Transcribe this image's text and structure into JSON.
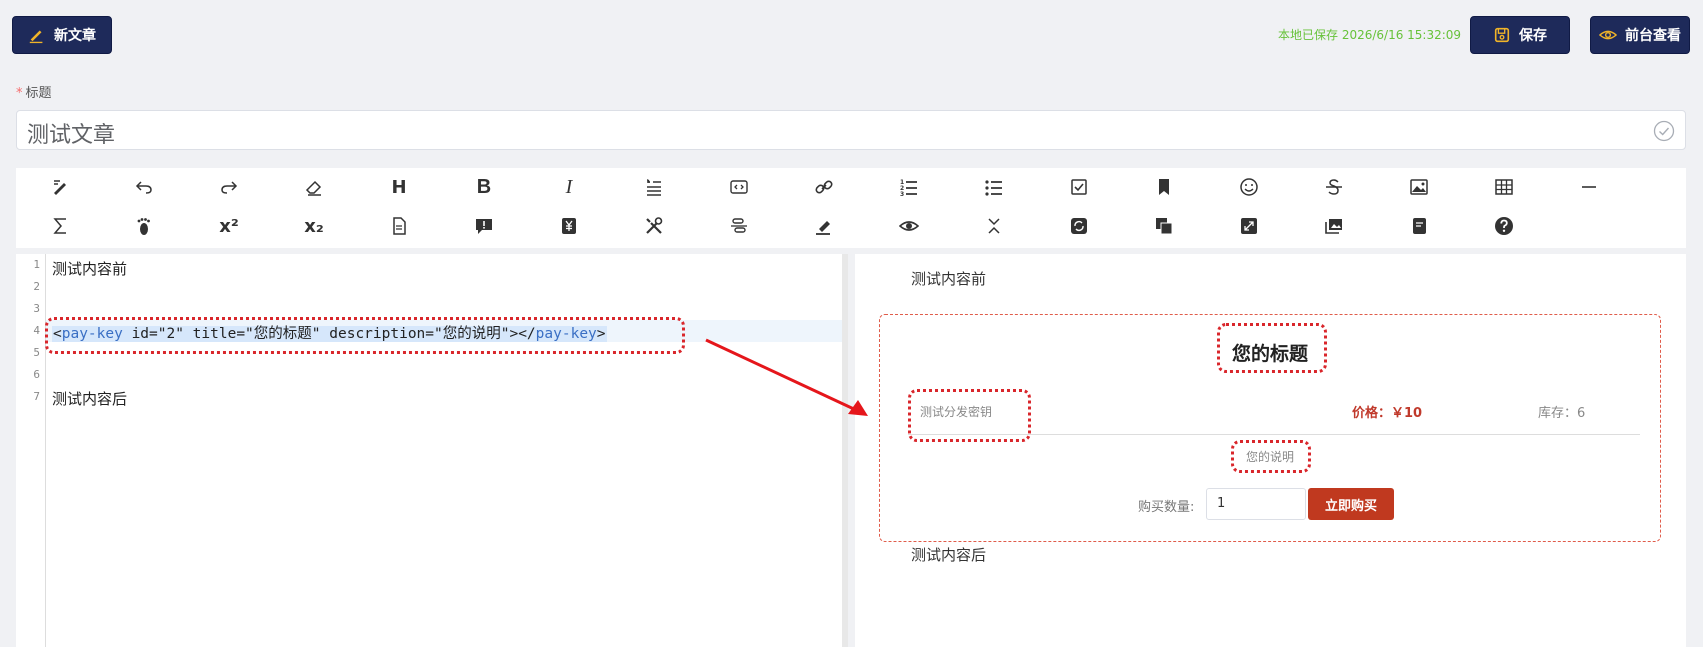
{
  "header": {
    "new_article": "新文章",
    "saved_status": "本地已保存 2026/6/16 15:32:09",
    "save": "保存",
    "view_front": "前台查看"
  },
  "title_field": {
    "required_mark": "*",
    "label": "标题",
    "value": "测试文章"
  },
  "toolbar": {
    "row1": [
      "edit-pen-icon",
      "undo-icon",
      "redo-icon",
      "eraser-icon",
      "heading-icon",
      "bold-icon",
      "italic-icon",
      "quote-icon",
      "code-block-icon",
      "link-icon",
      "ordered-list-icon",
      "unordered-list-icon",
      "checklist-icon",
      "bookmark-icon",
      "emoji-icon",
      "strikethrough-icon",
      "image-icon",
      "table-icon",
      "horizontal-rule-icon"
    ],
    "row2": [
      "formula-icon",
      "footnote-icon",
      "superscript-icon",
      "subscript-icon",
      "document-icon",
      "alert-icon",
      "yen-icon",
      "tools-icon",
      "align-icon",
      "highlighter-icon",
      "preview-eye-icon",
      "collapse-icon",
      "sync-icon",
      "copy-icon",
      "fullscreen-icon",
      "gallery-icon",
      "notebook-icon",
      "help-icon"
    ],
    "labels": {
      "heading": "H",
      "bold": "B",
      "italic": "I",
      "superscript": "x²",
      "subscript": "x₂"
    }
  },
  "editor": {
    "line_numbers": [
      "1",
      "2",
      "3",
      "4",
      "5",
      "6",
      "7"
    ],
    "line1": "测试内容前",
    "line4_parts": {
      "open_bracket": "<",
      "tag": "pay-key",
      "attrs": " id=\"2\" title=\"您的标题\" description=\"您的说明\">",
      "close_bracket": "</",
      "close_tag": "pay-key",
      "end": ">"
    },
    "line7": "测试内容后"
  },
  "preview": {
    "before": "测试内容前",
    "after": "测试内容后",
    "card": {
      "title": "您的标题",
      "name": "测试分发密钥",
      "price": "价格：￥10",
      "stock": "库存：6",
      "description": "您的说明",
      "qty_label": "购买数量:",
      "qty_value": "1",
      "buy_button": "立即购买"
    }
  },
  "colors": {
    "dark_button": "#1e2a5a",
    "saved_green": "#67c23a",
    "accent_red": "#d9262b",
    "buy_red": "#c0391f",
    "tag_blue": "#3a6fc4"
  }
}
